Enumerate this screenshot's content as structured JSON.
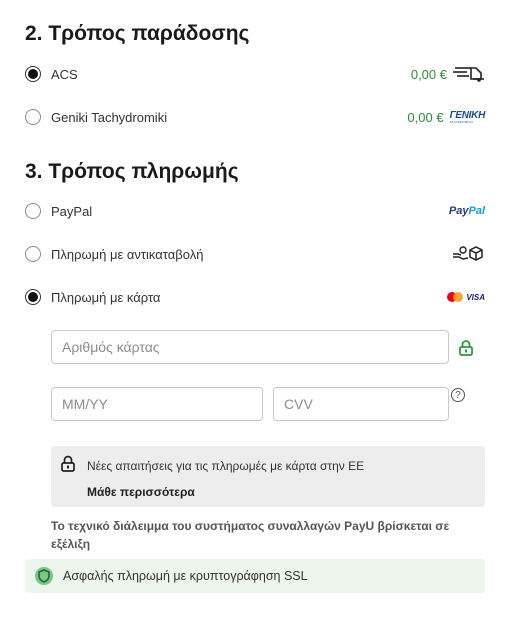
{
  "delivery": {
    "heading": "2. Τρόπος παράδοσης",
    "options": [
      {
        "label": "ACS",
        "price": "0,00 €",
        "selected": true,
        "icon": "delivery-truck-icon"
      },
      {
        "label": "Geniki Tachydromiki",
        "price": "0,00 €",
        "selected": false,
        "icon": "geniki-logo-icon",
        "logo_text": "ΓΕΝΙΚΗ",
        "logo_subtext": "ΤΑΧΥΔΡΟΜΙΚΗ"
      }
    ]
  },
  "payment": {
    "heading": "3. Τρόπος πληρωμής",
    "options": [
      {
        "label": "PayPal",
        "selected": false,
        "icon": "paypal-logo-icon",
        "logo_text_a": "Pay",
        "logo_text_b": "Pal"
      },
      {
        "label": "Πληρωμή με αντικαταβολή",
        "selected": false,
        "icon": "cash-on-delivery-icon"
      },
      {
        "label": "Πληρωμή με κάρτα",
        "selected": true,
        "icon": "mastercard-visa-icon",
        "visa_text": "VISA"
      }
    ]
  },
  "card_form": {
    "number_placeholder": "Αριθμός κάρτας",
    "expiry_placeholder": "MM/YY",
    "cvv_placeholder": "CVV",
    "help_symbol": "?"
  },
  "notice": {
    "text": "Νέες απαιτήσεις για τις πληρωμές με κάρτα στην ΕΕ",
    "link": "Μάθε περισσότερα"
  },
  "payu_message": "Το τεχνικό διάλειμμα του συστήματος συναλλαγών PayU βρίσκεται σε εξέλιξη",
  "ssl_text": "Ασφαλής πληρωμή με κρυπτογράφηση SSL",
  "colors": {
    "accent_green": "#2e8b3c",
    "brand_paypal_dark": "#253b80",
    "brand_paypal_light": "#179bd7"
  }
}
